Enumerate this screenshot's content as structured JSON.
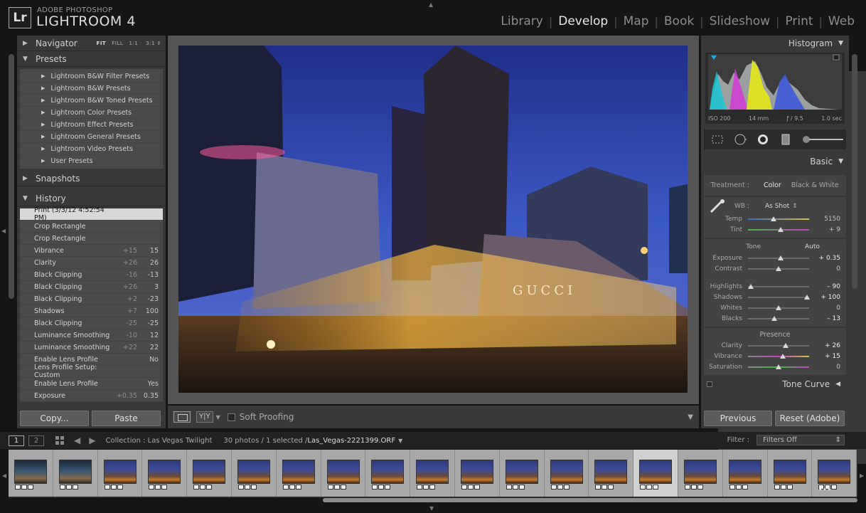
{
  "app": {
    "logo_text": "Lr",
    "brand_small": "ADOBE PHOTOSHOP",
    "brand_big": "LIGHTROOM 4"
  },
  "modules": [
    "Library",
    "Develop",
    "Map",
    "Book",
    "Slideshow",
    "Print",
    "Web"
  ],
  "active_module": "Develop",
  "left_panel": {
    "navigator": {
      "title": "Navigator",
      "options": [
        "FIT",
        "FILL",
        "1:1",
        "3:1"
      ]
    },
    "presets": {
      "title": "Presets",
      "items": [
        "Lightroom B&W Filter Presets",
        "Lightroom B&W Presets",
        "Lightroom B&W Toned Presets",
        "Lightroom Color Presets",
        "Lightroom Effect Presets",
        "Lightroom General Presets",
        "Lightroom Video Presets",
        "User Presets"
      ]
    },
    "snapshots": {
      "title": "Snapshots"
    },
    "history": {
      "title": "History",
      "items": [
        {
          "name": "Print (3/3/12 4:52:54 PM)",
          "delta": "",
          "value": ""
        },
        {
          "name": "Crop Rectangle",
          "delta": "",
          "value": ""
        },
        {
          "name": "Crop Rectangle",
          "delta": "",
          "value": ""
        },
        {
          "name": "Vibrance",
          "delta": "+15",
          "value": "15"
        },
        {
          "name": "Clarity",
          "delta": "+26",
          "value": "26"
        },
        {
          "name": "Black Clipping",
          "delta": "-16",
          "value": "-13"
        },
        {
          "name": "Black Clipping",
          "delta": "+26",
          "value": "3"
        },
        {
          "name": "Black Clipping",
          "delta": "+2",
          "value": "-23"
        },
        {
          "name": "Shadows",
          "delta": "+7",
          "value": "100"
        },
        {
          "name": "Black Clipping",
          "delta": "-25",
          "value": "-25"
        },
        {
          "name": "Luminance Smoothing",
          "delta": "-10",
          "value": "12"
        },
        {
          "name": "Luminance Smoothing",
          "delta": "+22",
          "value": "22"
        },
        {
          "name": "Enable Lens Profile",
          "delta": "",
          "value": "No"
        },
        {
          "name": "Lens Profile Setup: Custom",
          "delta": "",
          "value": ""
        },
        {
          "name": "Enable Lens Profile",
          "delta": "",
          "value": "Yes"
        },
        {
          "name": "Exposure",
          "delta": "+0.35",
          "value": "0.35"
        }
      ]
    },
    "copy_label": "Copy...",
    "paste_label": "Paste"
  },
  "toolbar": {
    "yy_label": "Y|Y",
    "soft_proofing": "Soft Proofing"
  },
  "right_panel": {
    "histogram": {
      "title": "Histogram",
      "iso": "ISO 200",
      "focal": "14 mm",
      "aperture": "ƒ / 9.5",
      "shutter": "1.0 sec"
    },
    "basic": {
      "title": "Basic",
      "treatment_label": "Treatment :",
      "treatment_color": "Color",
      "treatment_bw": "Black & White",
      "wb_label": "WB :",
      "wb_value": "As Shot",
      "temp": {
        "label": "Temp",
        "value": "5150",
        "pos": 0.42
      },
      "tint": {
        "label": "Tint",
        "value": "+ 9",
        "pos": 0.53
      },
      "tone_title": "Tone",
      "auto_label": "Auto",
      "exposure": {
        "label": "Exposure",
        "value": "+ 0.35",
        "pos": 0.53
      },
      "contrast": {
        "label": "Contrast",
        "value": "0",
        "pos": 0.5
      },
      "highlights": {
        "label": "Highlights",
        "value": "– 90",
        "pos": 0.05
      },
      "shadows": {
        "label": "Shadows",
        "value": "+ 100",
        "pos": 0.96
      },
      "whites": {
        "label": "Whites",
        "value": "0",
        "pos": 0.5
      },
      "blacks": {
        "label": "Blacks",
        "value": "– 13",
        "pos": 0.43
      },
      "presence_title": "Presence",
      "clarity": {
        "label": "Clarity",
        "value": "+ 26",
        "pos": 0.62
      },
      "vibrance": {
        "label": "Vibrance",
        "value": "+ 15",
        "pos": 0.57
      },
      "saturation": {
        "label": "Saturation",
        "value": "0",
        "pos": 0.5
      }
    },
    "tone_curve_title": "Tone Curve",
    "previous_label": "Previous",
    "reset_label": "Reset (Adobe)"
  },
  "filmstrip": {
    "page1": "1",
    "page2": "2",
    "collection": "Collection : Las Vegas Twilight",
    "count": "30 photos / 1 selected /",
    "filename": "Las_Vegas-2221399.ORF",
    "filter_label": "Filter :",
    "filter_value": "Filters Off",
    "selected_index": 14,
    "count_thumbs": 19
  },
  "colors": {
    "accent": "#e8e8e8",
    "panel": "#393939",
    "background": "#151515"
  }
}
